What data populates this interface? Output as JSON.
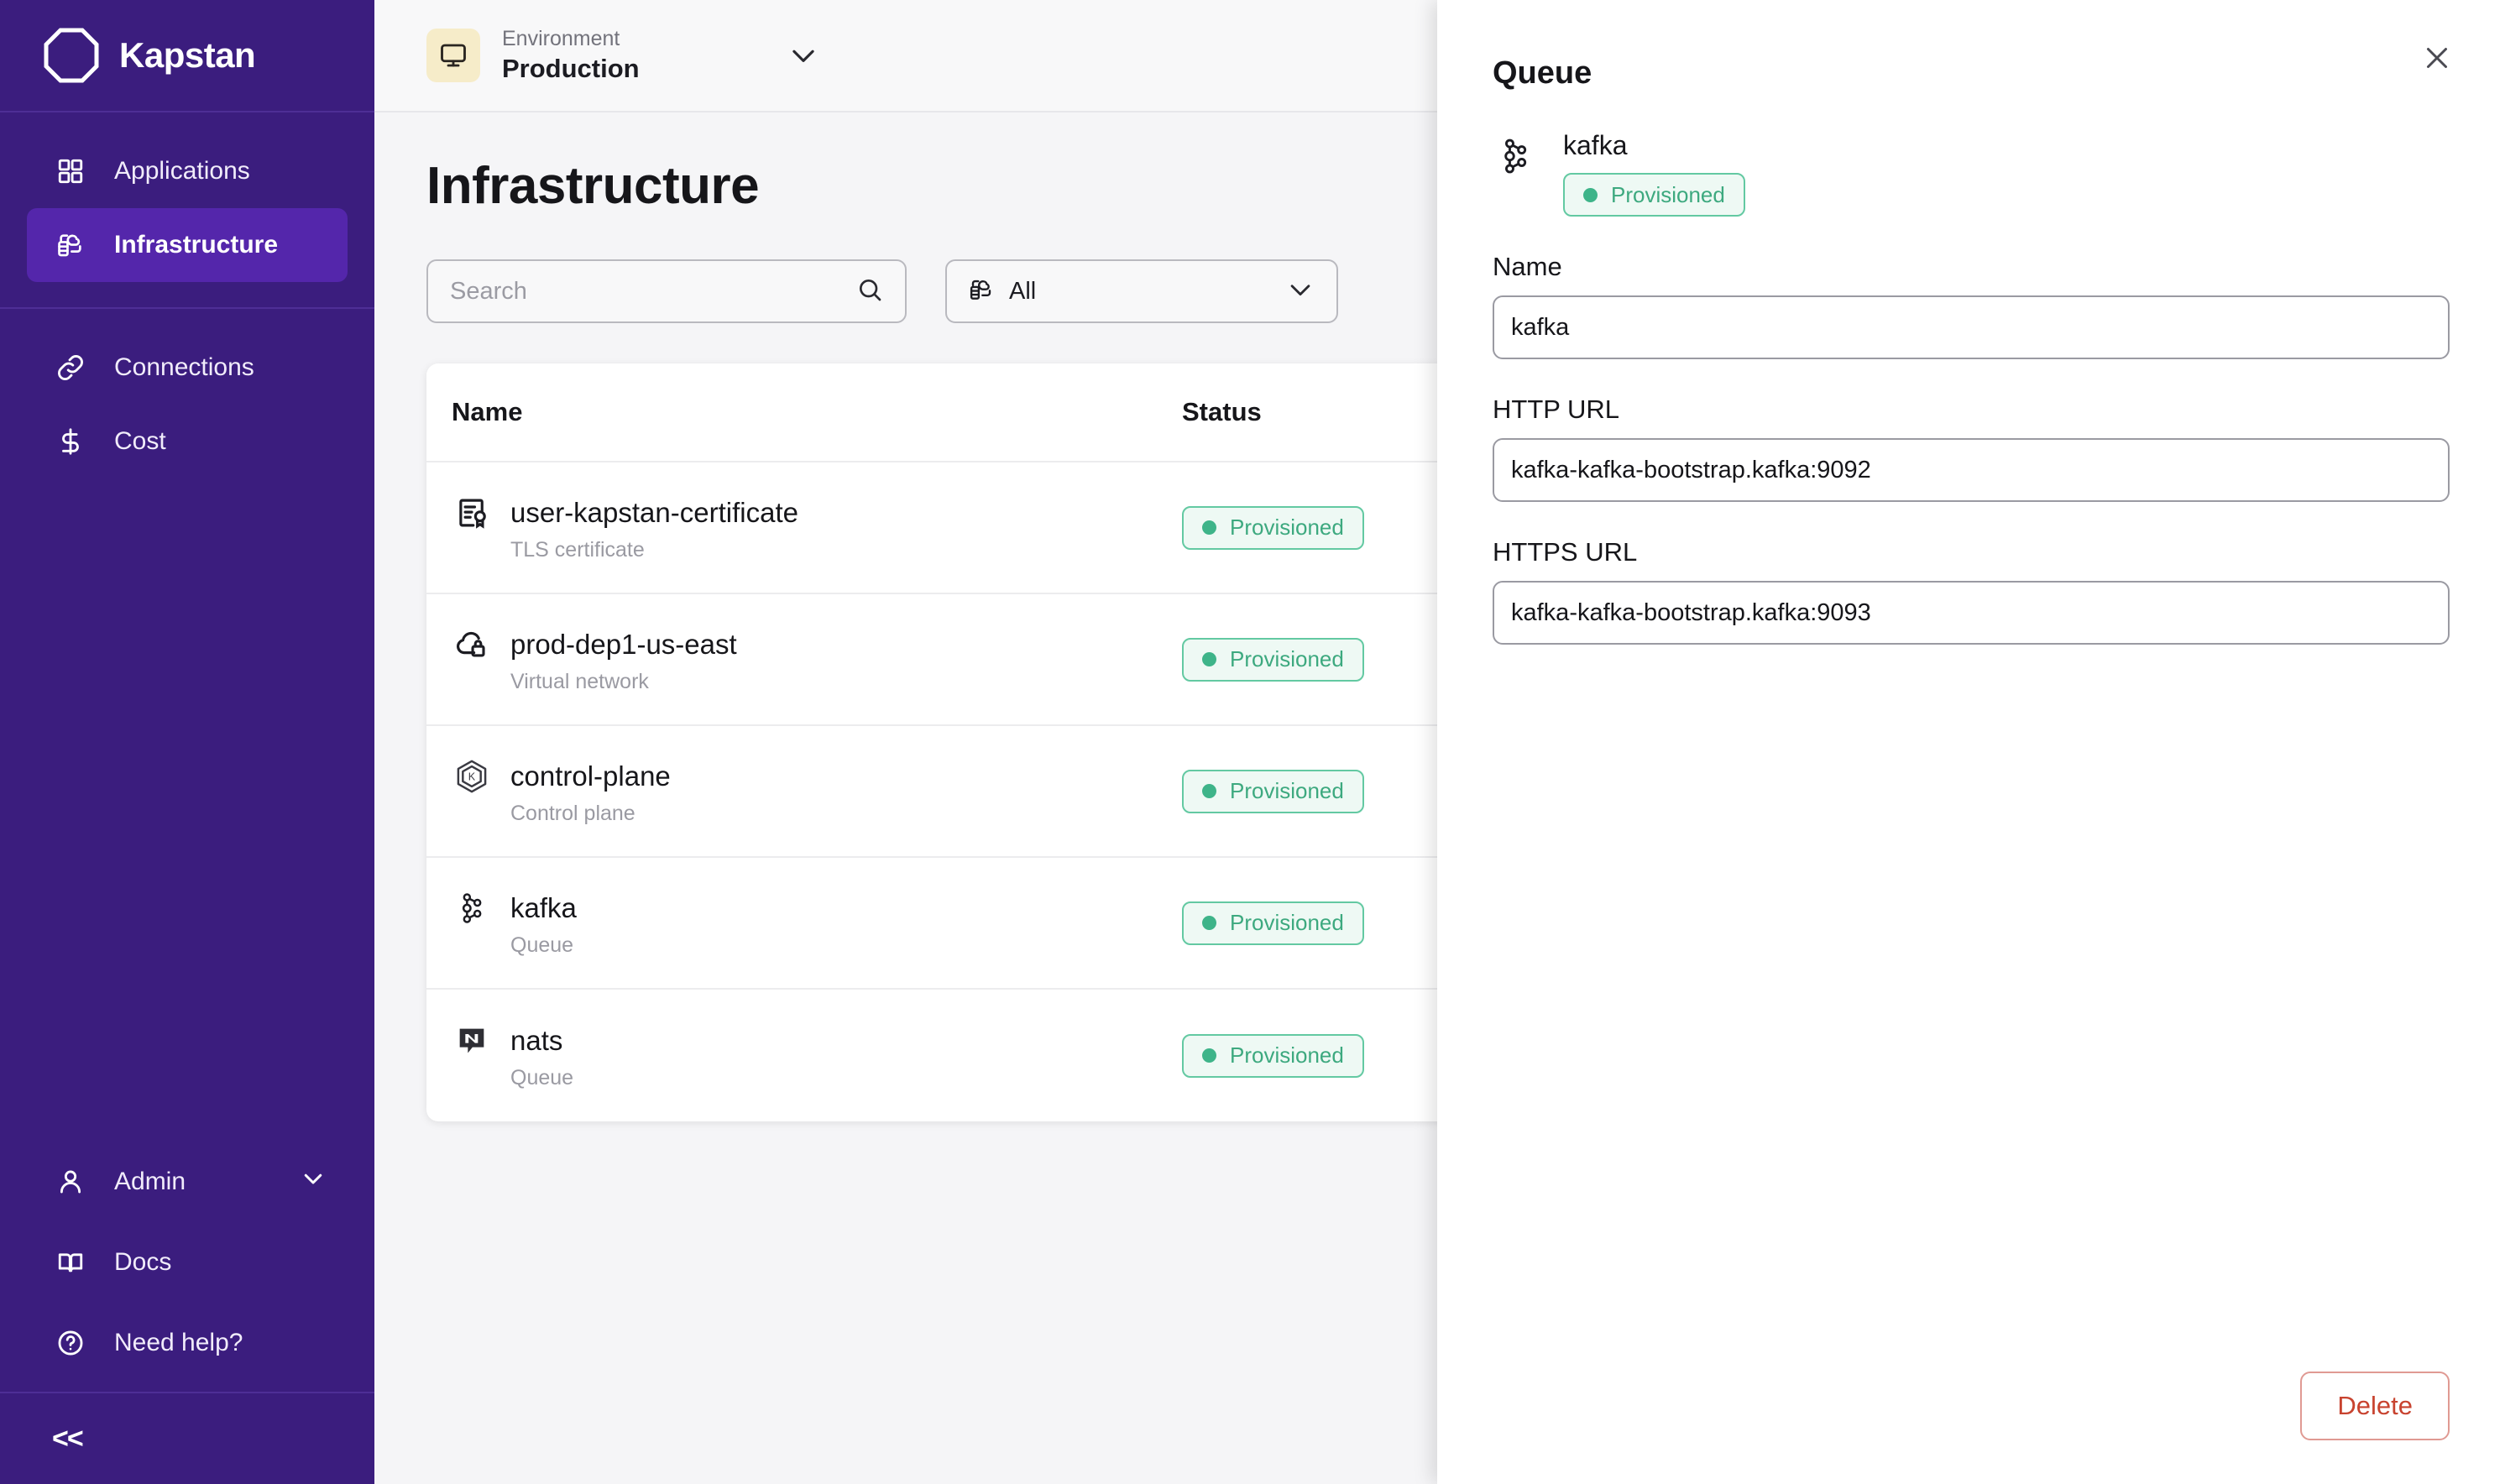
{
  "brand": {
    "name": "Kapstan",
    "logo_icon": "octagon-logo-icon"
  },
  "sidebar": {
    "primary_items": [
      {
        "label": "Applications",
        "icon": "grid-icon",
        "active": false
      },
      {
        "label": "Infrastructure",
        "icon": "infrastructure-icon",
        "active": true
      }
    ],
    "secondary_items": [
      {
        "label": "Connections",
        "icon": "link-icon"
      },
      {
        "label": "Cost",
        "icon": "dollar-icon"
      }
    ],
    "bottom_items": [
      {
        "label": "Admin",
        "icon": "user-icon",
        "chevron": "chevron-down-icon"
      },
      {
        "label": "Docs",
        "icon": "book-icon"
      },
      {
        "label": "Need help?",
        "icon": "question-circle-icon"
      }
    ],
    "collapse_glyph": "<<"
  },
  "topbar": {
    "env_icon": "monitor-icon",
    "env_label": "Environment",
    "env_value": "Production",
    "chevron": "chevron-down-icon"
  },
  "page": {
    "title": "Infrastructure",
    "search": {
      "placeholder": "Search",
      "value": "",
      "icon": "search-icon"
    },
    "filter": {
      "value": "All",
      "icon": "infrastructure-icon",
      "chevron": "chevron-down-icon"
    }
  },
  "table": {
    "columns": [
      "Name",
      "Status"
    ],
    "rows": [
      {
        "name": "user-kapstan-certificate",
        "subtitle": "TLS certificate",
        "icon": "certificate-icon",
        "status": "Provisioned"
      },
      {
        "name": "prod-dep1-us-east",
        "subtitle": "Virtual network",
        "icon": "cloud-lock-icon",
        "status": "Provisioned"
      },
      {
        "name": "control-plane",
        "subtitle": "Control plane",
        "icon": "kubernetes-icon",
        "status": "Provisioned"
      },
      {
        "name": "kafka",
        "subtitle": "Queue",
        "icon": "kafka-icon",
        "status": "Provisioned"
      },
      {
        "name": "nats",
        "subtitle": "Queue",
        "icon": "nats-icon",
        "status": "Provisioned"
      }
    ]
  },
  "panel": {
    "title": "Queue",
    "close_icon": "close-icon",
    "resource": {
      "name": "kafka",
      "icon": "kafka-icon",
      "status": "Provisioned"
    },
    "fields": [
      {
        "label": "Name",
        "value": "kafka"
      },
      {
        "label": "HTTP URL",
        "value": "kafka-kafka-bootstrap.kafka:9092"
      },
      {
        "label": "HTTPS URL",
        "value": "kafka-kafka-bootstrap.kafka:9093"
      }
    ],
    "delete_label": "Delete"
  },
  "colors": {
    "sidebar_bg": "#3b1d7e",
    "sidebar_active": "#5426ab",
    "status_green": "#3eb489",
    "status_bg": "#eef9f4",
    "delete_red": "#c8432f",
    "env_icon_bg": "#f6ecc9"
  }
}
